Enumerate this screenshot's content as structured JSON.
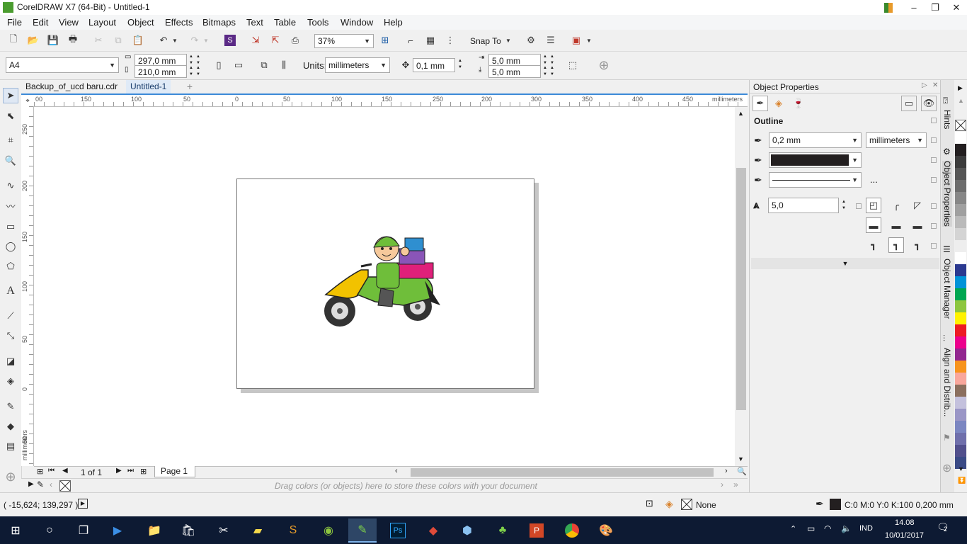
{
  "window": {
    "title": "CorelDRAW X7 (64-Bit) - Untitled-1",
    "controls": {
      "minimize": "–",
      "restore": "❐",
      "close": "✕"
    }
  },
  "menu": [
    "File",
    "Edit",
    "View",
    "Layout",
    "Object",
    "Effects",
    "Bitmaps",
    "Text",
    "Table",
    "Tools",
    "Window",
    "Help"
  ],
  "toolbar": {
    "zoom": "37%",
    "snap_to": "Snap To"
  },
  "property_bar": {
    "page_size": "A4",
    "width": "297,0 mm",
    "height": "210,0 mm",
    "units_label": "Units:",
    "units": "millimeters",
    "nudge": "0,1 mm",
    "dup_x": "5,0 mm",
    "dup_y": "5,0 mm"
  },
  "doc_tabs": [
    {
      "label": "Backup_of_ucd baru.cdr",
      "active": false
    },
    {
      "label": "Untitled-1",
      "active": true
    }
  ],
  "hruler": {
    "ticks": [
      "00",
      "150",
      "100",
      "50",
      "0",
      "50",
      "100",
      "150",
      "200",
      "250",
      "300",
      "350",
      "400",
      "450"
    ],
    "unit": "millimeters"
  },
  "vruler": {
    "ticks": [
      "250",
      "200",
      "150",
      "100",
      "50",
      "0",
      "50"
    ],
    "unit": "millimeters"
  },
  "page_nav": {
    "counter": "1 of 1",
    "tab": "Page 1"
  },
  "doc_palette_hint": "Drag colors (or objects) here to store these colors with your document",
  "docker": {
    "title": "Object Properties",
    "section": "Outline",
    "width": "0,2 mm",
    "units": "millimeters",
    "color": "#231f20",
    "miter_limit": "5,0",
    "more": "...",
    "side_tabs": [
      "Hints",
      "Object Properties",
      "Object Manager",
      "Align and Distrib..."
    ]
  },
  "palette_colors": [
    "#ffffff",
    "#231f20",
    "#3c3c3c",
    "#555555",
    "#6d6d6d",
    "#878787",
    "#a0a0a0",
    "#bababa",
    "#d4d4d4",
    "#eeeeee",
    "#ffffff",
    "#2b3990",
    "#0093d8",
    "#00a651",
    "#8dc63f",
    "#fff200",
    "#ed1c24",
    "#ec008c",
    "#92278f",
    "#f7941d",
    "#f9a79c",
    "#8b6f5e",
    "#c4c1dd",
    "#9a96c6",
    "#7b86c1",
    "#6f6fab",
    "#514f8c",
    "#3a4a86"
  ],
  "status": {
    "coords": "( -15,624; 139,297 )",
    "fill": "None",
    "outline": "C:0 M:0 Y:0 K:100  0,200 mm"
  },
  "taskbar": {
    "lang": "IND",
    "time": "14.08",
    "date": "10/01/2017",
    "notif": "2"
  }
}
